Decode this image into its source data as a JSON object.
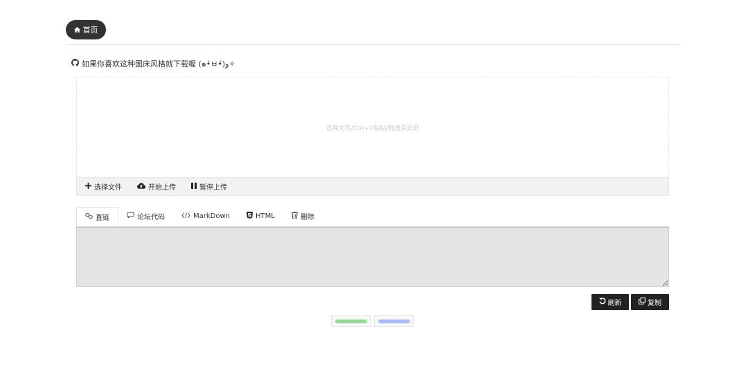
{
  "nav": {
    "home_label": "首页"
  },
  "promo": {
    "text": "如果你喜欢这种图床风格就下载喔 (๑•̀ㅂ•́)و✧"
  },
  "dropzone": {
    "hint": "选择文件/Ctrl+V粘贴/拖拽至此处"
  },
  "toolbar": {
    "select_files": "选择文件",
    "start_upload": "开始上传",
    "pause_upload": "暂停上传"
  },
  "tabs": [
    {
      "label": "直链",
      "icon": "link-icon",
      "active": true
    },
    {
      "label": "论坛代码",
      "icon": "comment-icon",
      "active": false
    },
    {
      "label": "MarkDown",
      "icon": "code-icon",
      "active": false
    },
    {
      "label": "HTML",
      "icon": "html5-icon",
      "active": false
    },
    {
      "label": "删除",
      "icon": "trash-icon",
      "active": false
    }
  ],
  "output": {
    "value": ""
  },
  "actions": {
    "refresh_label": "刷新",
    "copy_label": "复制"
  },
  "colors": {
    "primary_dark": "#222222",
    "badge_green": "#7cc47a",
    "badge_blue": "#8aa2e8"
  }
}
